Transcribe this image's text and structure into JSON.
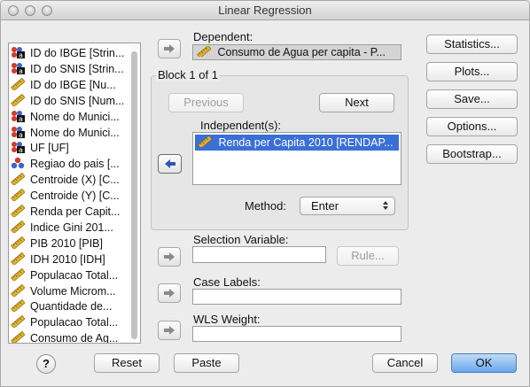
{
  "window": {
    "title": "Linear Regression"
  },
  "variables": [
    {
      "label": "ID do IBGE [Strin...",
      "icon": "nominal-string-icon"
    },
    {
      "label": "ID do SNIS [Strin...",
      "icon": "nominal-string-icon"
    },
    {
      "label": "ID do IBGE [Nu...",
      "icon": "scale-icon"
    },
    {
      "label": "ID do SNIS [Num...",
      "icon": "scale-icon"
    },
    {
      "label": "Nome do Munici...",
      "icon": "nominal-string-icon"
    },
    {
      "label": "Nome do Munici...",
      "icon": "nominal-string-icon"
    },
    {
      "label": "UF [UF]",
      "icon": "nominal-string-icon"
    },
    {
      "label": "Regiao do pais [...",
      "icon": "nominal-icon"
    },
    {
      "label": "Centroide (X) [C...",
      "icon": "scale-icon"
    },
    {
      "label": "Centroide (Y) [C...",
      "icon": "scale-icon"
    },
    {
      "label": "Renda per Capit...",
      "icon": "scale-icon"
    },
    {
      "label": "Indice Gini 201...",
      "icon": "scale-icon"
    },
    {
      "label": "PIB 2010 [PIB]",
      "icon": "scale-icon"
    },
    {
      "label": "IDH 2010 [IDH]",
      "icon": "scale-icon"
    },
    {
      "label": "Populacao Total...",
      "icon": "scale-icon"
    },
    {
      "label": "Volume Microm...",
      "icon": "scale-icon"
    },
    {
      "label": "Quantidade de...",
      "icon": "scale-icon"
    },
    {
      "label": "Populacao Total...",
      "icon": "scale-icon"
    },
    {
      "label": "Consumo de Ag...",
      "icon": "scale-icon"
    }
  ],
  "dependent": {
    "label": "Dependent:",
    "value": "Consumo de Agua per capita - P..."
  },
  "block": {
    "label": "Block 1 of 1",
    "previous": "Previous",
    "next": "Next",
    "independents_label": "Independent(s):",
    "independents": [
      "Renda per Capita 2010 [RENDAP..."
    ],
    "method_label": "Method:",
    "method_value": "Enter"
  },
  "selection": {
    "label": "Selection Variable:",
    "value": "",
    "rule_button": "Rule..."
  },
  "case_labels": {
    "label": "Case Labels:",
    "value": ""
  },
  "wls": {
    "label": "WLS Weight:",
    "value": ""
  },
  "side_buttons": {
    "statistics": "Statistics...",
    "plots": "Plots...",
    "save": "Save...",
    "options": "Options...",
    "bootstrap": "Bootstrap..."
  },
  "bottom_buttons": {
    "help": "?",
    "reset": "Reset",
    "paste": "Paste",
    "cancel": "Cancel",
    "ok": "OK"
  },
  "colors": {
    "selection": "#3a6fd6",
    "default_button": "#6aa7ea",
    "ruler": "#e1b12c",
    "nominal_red": "#d23a2e",
    "nominal_blue": "#3d66c9"
  }
}
